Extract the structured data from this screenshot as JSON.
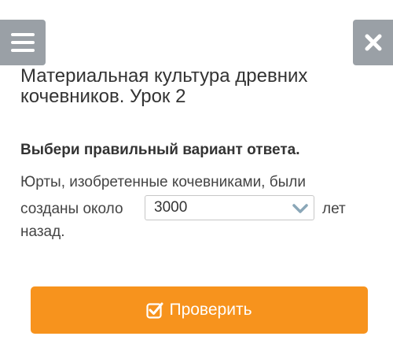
{
  "header": {
    "menu_icon": "hamburger-icon",
    "close_icon": "close-icon",
    "button_color": "#9aa0a6"
  },
  "lesson": {
    "title": "Материальная культура древних кочевников. Урок 2"
  },
  "task": {
    "instruction": "Выбери правильный вариант ответа.",
    "question_line1": "Юрты, изобретенные кочевниками, были",
    "question_before_select": "созданы около",
    "selected_answer": "3000",
    "question_after_select": "лет",
    "question_line3": "назад."
  },
  "actions": {
    "check_label": "Проверить",
    "check_icon": "checkbox-check-icon",
    "check_color": "#f7931d"
  }
}
